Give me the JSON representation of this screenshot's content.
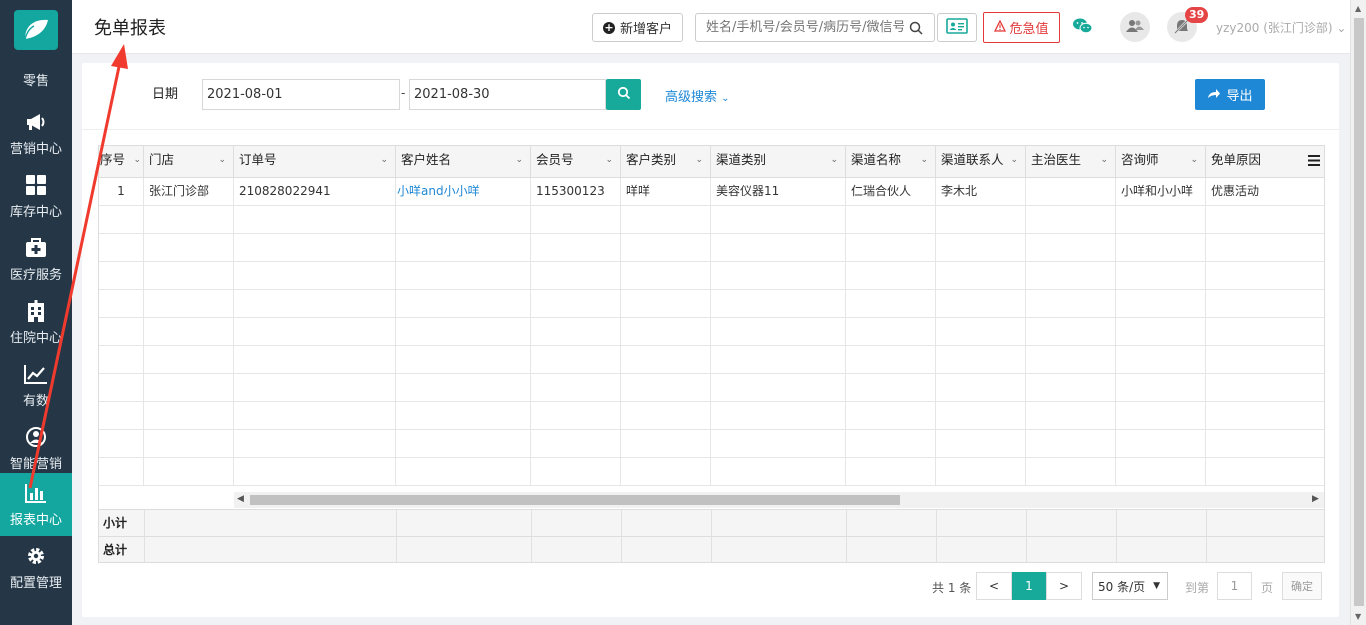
{
  "sidebar": {
    "items": [
      {
        "label": "零售",
        "icon": "retail-icon"
      },
      {
        "label": "营销中心",
        "icon": "megaphone-icon"
      },
      {
        "label": "库存中心",
        "icon": "grid-icon"
      },
      {
        "label": "医疗服务",
        "icon": "medical-kit-icon"
      },
      {
        "label": "住院中心",
        "icon": "hospital-icon"
      },
      {
        "label": "有数",
        "icon": "line-chart-icon"
      },
      {
        "label": "智能营销",
        "icon": "smart-marketing-icon"
      },
      {
        "label": "报表中心",
        "icon": "bar-chart-icon"
      },
      {
        "label": "配置管理",
        "icon": "gear-icon"
      }
    ],
    "active_index": 7
  },
  "header": {
    "title": "免单报表",
    "add_customer_label": "新增客户",
    "search_placeholder": "姓名/手机号/会员号/病历号/微信号",
    "danger_label": "危急值",
    "notification_count": "39",
    "user": "yzy200 (张江门诊部)"
  },
  "filters": {
    "date_label": "日期",
    "start_date": "2021-08-01",
    "end_date": "2021-08-30",
    "separator": "-",
    "advanced_label": "高级搜索",
    "export_label": "导出"
  },
  "table": {
    "columns": [
      "序号",
      "门店",
      "订单号",
      "客户姓名",
      "会员号",
      "客户类别",
      "渠道类别",
      "渠道名称",
      "渠道联系人",
      "主治医生",
      "咨询师",
      "免单原因"
    ],
    "rows": [
      [
        "1",
        "张江门诊部",
        "210828022941",
        "小咩and小小咩",
        "115300123",
        "咩咩",
        "美容仪器11",
        "仁瑞合伙人",
        "李木北",
        "",
        "小咩和小小咩",
        "优惠活动"
      ]
    ],
    "subtotal_label": "小计",
    "total_label": "总计"
  },
  "pagination": {
    "total_text": "共 1 条",
    "prev": "<",
    "current_page": "1",
    "next": ">",
    "page_size": "50 条/页",
    "goto_label": "到第",
    "goto_value": "1",
    "page_label": "页",
    "confirm_label": "确定"
  },
  "colors": {
    "sidebar_bg": "#253746",
    "accent": "#13a7a0",
    "primary_blue": "#1f88d6",
    "danger": "#e23a3a"
  }
}
